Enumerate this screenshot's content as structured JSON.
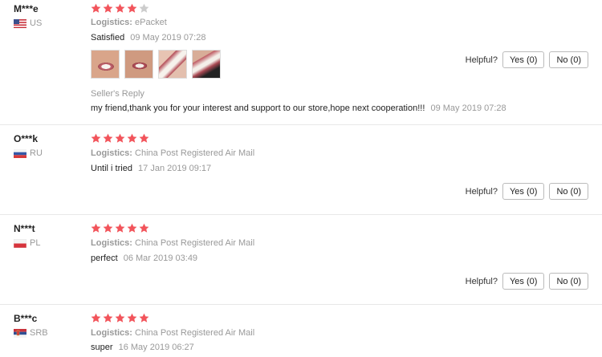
{
  "helpful_label": "Helpful?",
  "colors": {
    "star_on": "#f2545b",
    "star_off": "#cccccc"
  },
  "reviews": [
    {
      "name": "M***e",
      "country": "US",
      "flag": "us-flag-icon",
      "rating": 4,
      "logistics_label": "Logistics:",
      "logistics_value": "ePacket",
      "text": "Satisfied",
      "date": "09 May 2019 07:28",
      "images": [
        "smile-photo-1",
        "smile-photo-2",
        "smile-photo-3",
        "smile-photo-4"
      ],
      "reply_label": "Seller's Reply",
      "reply_text": "my friend,thank you for your interest and support to our store,hope next cooperation!!!",
      "reply_date": "09 May 2019 07:28",
      "yes": "Yes (0)",
      "no": "No (0)"
    },
    {
      "name": "O***k",
      "country": "RU",
      "flag": "ru-flag-icon",
      "rating": 5,
      "logistics_label": "Logistics:",
      "logistics_value": "China Post Registered Air Mail",
      "text": "Until i tried",
      "date": "17 Jan 2019 09:17",
      "yes": "Yes (0)",
      "no": "No (0)"
    },
    {
      "name": "N***t",
      "country": "PL",
      "flag": "pl-flag-icon",
      "rating": 5,
      "logistics_label": "Logistics:",
      "logistics_value": "China Post Registered Air Mail",
      "text": "perfect",
      "date": "06 Mar 2019 03:49",
      "yes": "Yes (0)",
      "no": "No (0)"
    },
    {
      "name": "B***c",
      "country": "SRB",
      "flag": "rs-flag-icon",
      "rating": 5,
      "logistics_label": "Logistics:",
      "logistics_value": "China Post Registered Air Mail",
      "text": "super",
      "date": "16 May 2019 06:27"
    }
  ]
}
